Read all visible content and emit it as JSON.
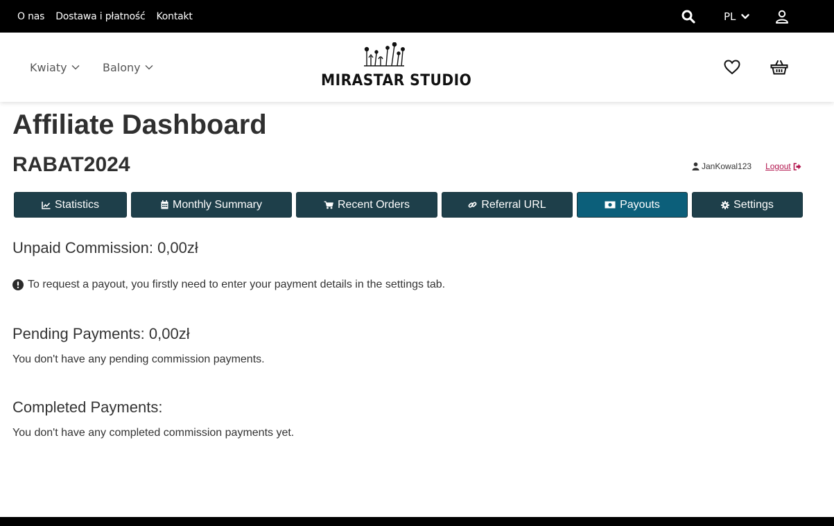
{
  "topbar": {
    "links": [
      "O nas",
      "Dostawa i płatność",
      "Kontakt"
    ],
    "language": "PL",
    "icons": {
      "search": "search-icon",
      "user": "user-icon",
      "lang_caret": "chevron-down-icon"
    }
  },
  "header": {
    "menu": [
      {
        "label": "Kwiaty"
      },
      {
        "label": "Balony"
      }
    ],
    "logo_text": "MIRASTAR STUDIO",
    "icons": {
      "wishlist": "heart-icon",
      "cart": "basket-icon"
    }
  },
  "page": {
    "title": "Affiliate Dashboard",
    "code": "RABAT2024",
    "username": "JanKowal123",
    "logout_label": "Logout"
  },
  "tabs": [
    {
      "label": "Statistics",
      "icon": "line-chart-icon"
    },
    {
      "label": "Monthly Summary",
      "icon": "calendar-icon"
    },
    {
      "label": "Recent Orders",
      "icon": "cart-icon"
    },
    {
      "label": "Referral URL",
      "icon": "link-icon"
    },
    {
      "label": "Payouts",
      "icon": "money-icon",
      "active": true
    },
    {
      "label": "Settings",
      "icon": "gear-icon"
    }
  ],
  "payouts": {
    "unpaid_heading": "Unpaid Commission: 0,00zł",
    "notice": "To request a payout, you firstly need to enter your payment details in the settings tab.",
    "pending_heading": "Pending Payments: 0,00zł",
    "pending_text": "You don't have any pending commission payments.",
    "completed_heading": "Completed Payments:",
    "completed_text": "You don't have any completed commission payments yet."
  },
  "colors": {
    "tab_bg": "#1e3f4a",
    "tab_active_bg": "#0c5f7a",
    "logout_link": "#b3164f",
    "topbar_bg": "#000000"
  }
}
